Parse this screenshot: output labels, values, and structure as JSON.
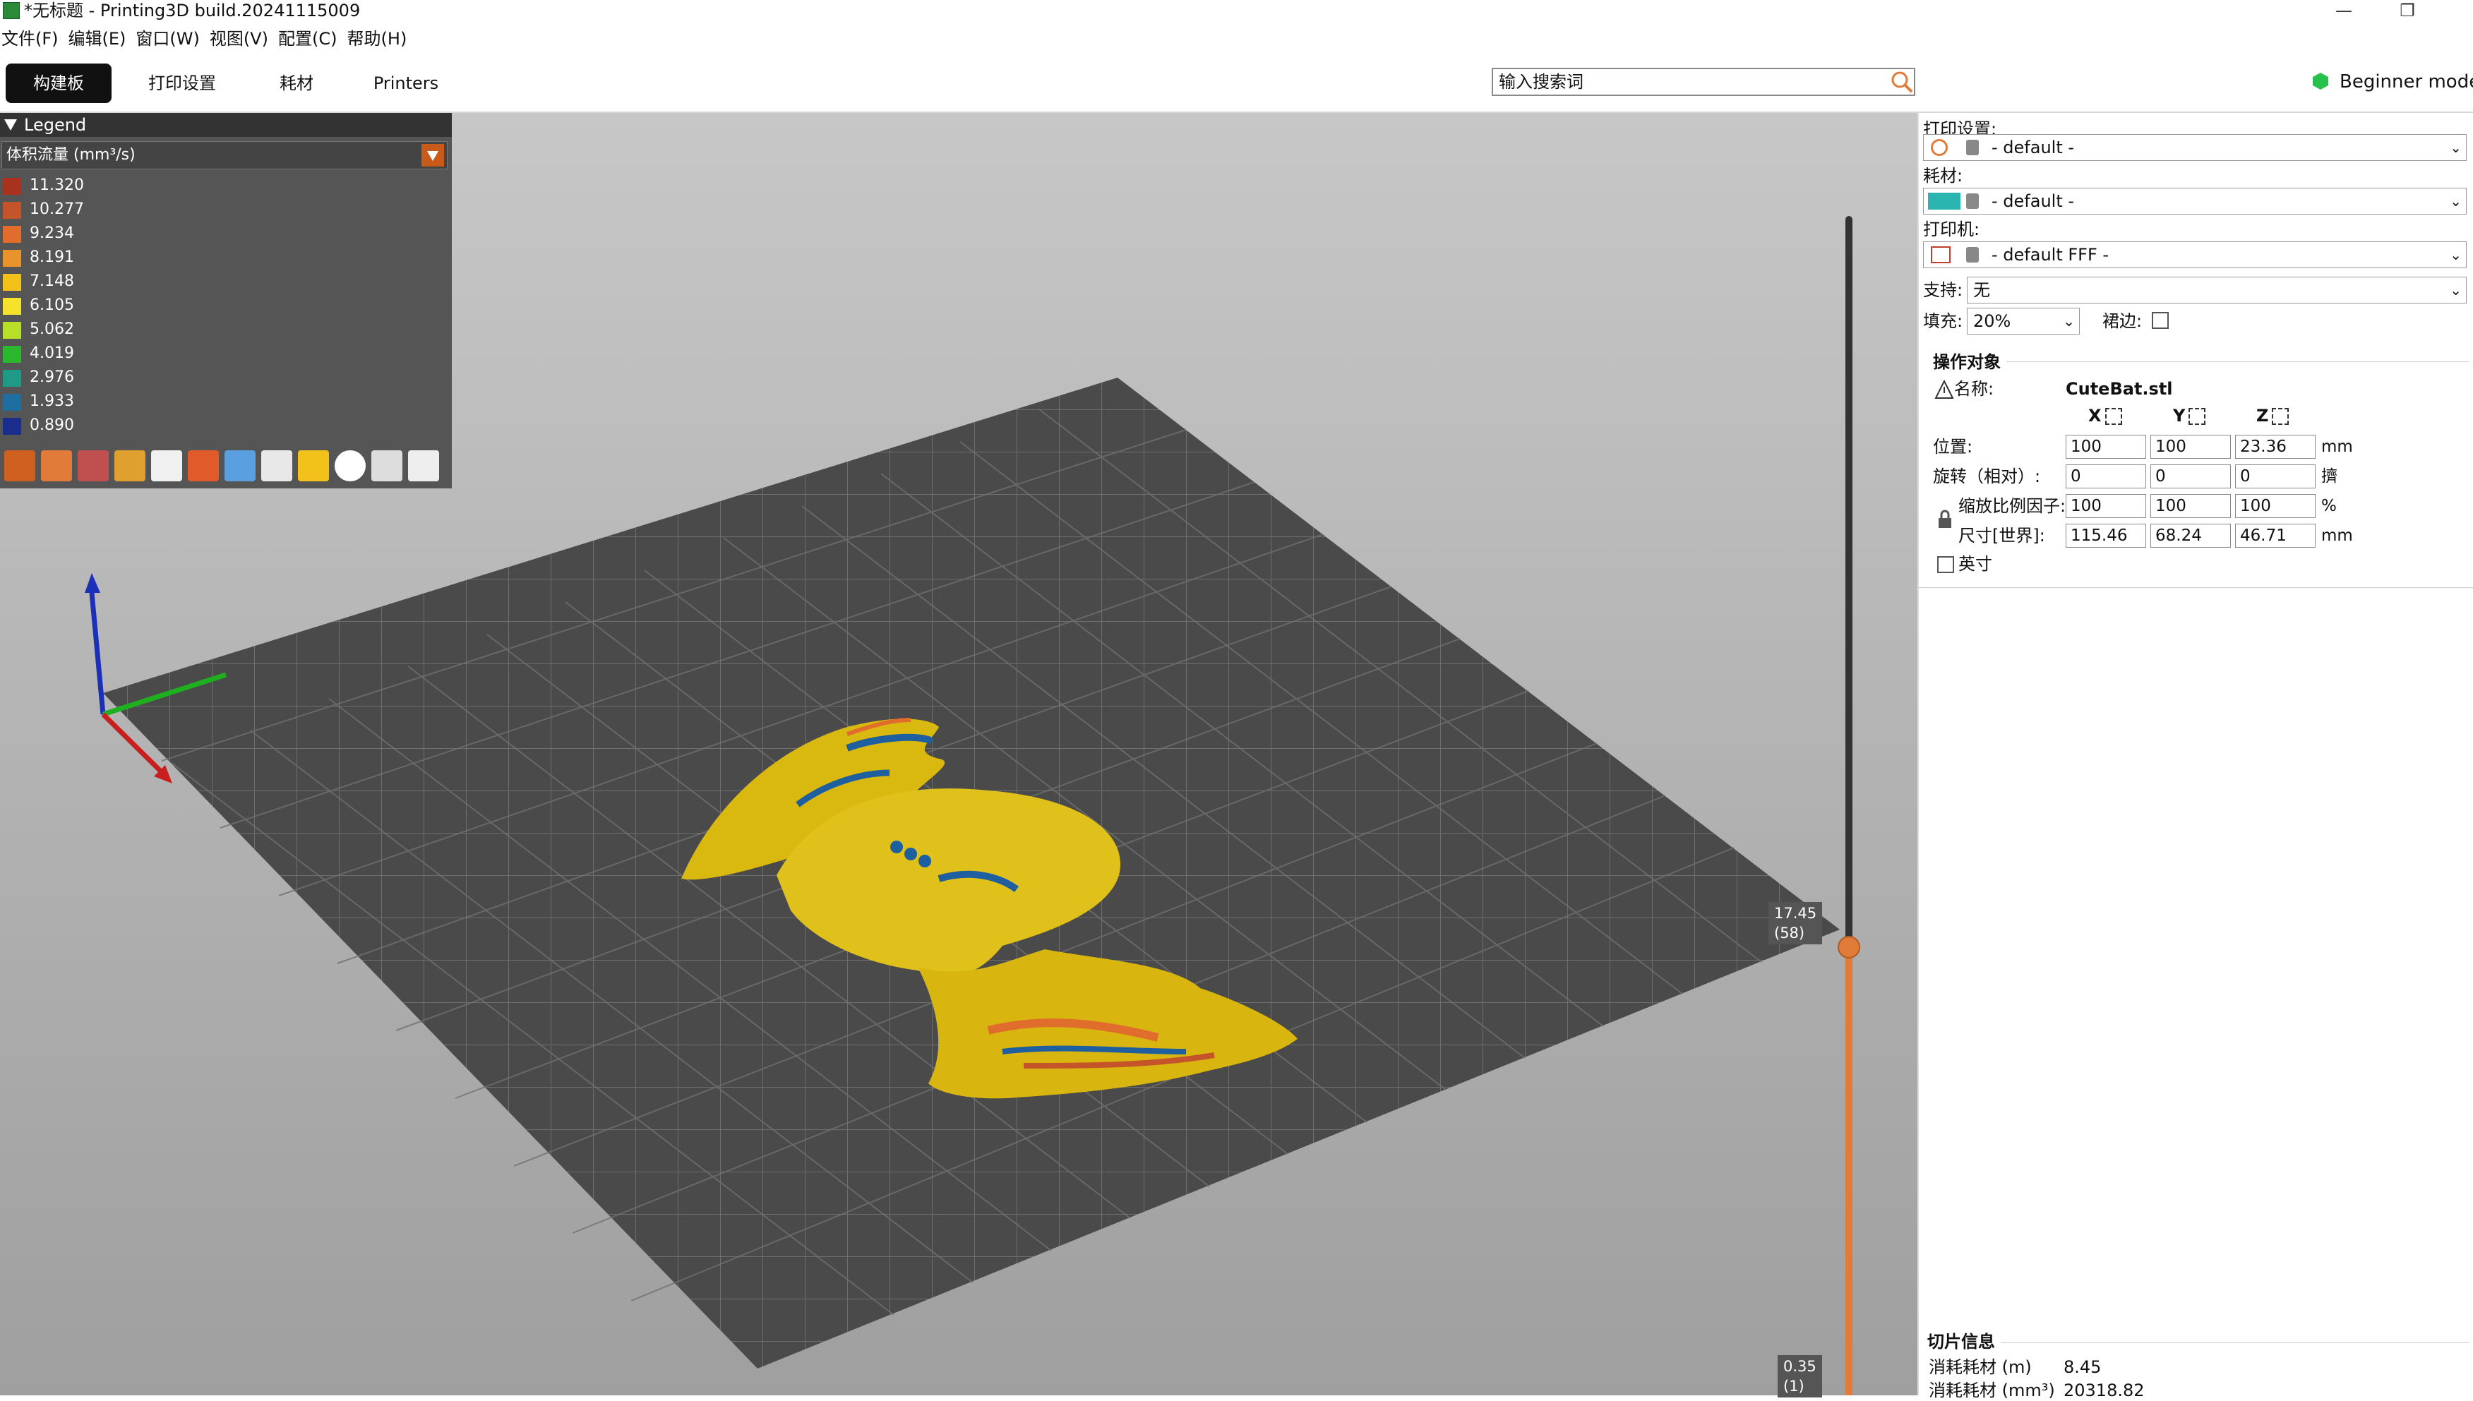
{
  "window": {
    "title": "*无标题 - Printing3D build.20241115009",
    "minimize": "—",
    "restore": "❐"
  },
  "menu": [
    "文件(F)",
    "编辑(E)",
    "窗口(W)",
    "视图(V)",
    "配置(C)",
    "帮助(H)"
  ],
  "tabs": [
    {
      "label": "构建板",
      "active": true
    },
    {
      "label": "打印设置",
      "active": false
    },
    {
      "label": "耗材",
      "active": false
    },
    {
      "label": "Printers",
      "active": false
    }
  ],
  "search": {
    "placeholder": "输入搜索词"
  },
  "mode": {
    "label": "Beginner mode",
    "color": "#27c24c"
  },
  "legend": {
    "title": "Legend",
    "metric": "体积流量 (mm³/s)",
    "items": [
      {
        "value": "11.320",
        "color": "#a8321e"
      },
      {
        "value": "10.277",
        "color": "#c4552a"
      },
      {
        "value": "9.234",
        "color": "#e06d2c"
      },
      {
        "value": "8.191",
        "color": "#e8932b"
      },
      {
        "value": "7.148",
        "color": "#f2c21a"
      },
      {
        "value": "6.105",
        "color": "#f5e22a"
      },
      {
        "value": "5.062",
        "color": "#b8e02a"
      },
      {
        "value": "4.019",
        "color": "#2bb82e"
      },
      {
        "value": "2.976",
        "color": "#1f9a86"
      },
      {
        "value": "1.933",
        "color": "#1e6fa0"
      },
      {
        "value": "0.890",
        "color": "#1a2d8c"
      }
    ]
  },
  "slider": {
    "top_label": "17.45",
    "top_layer": "(58)",
    "bottom_label": "0.35",
    "bottom_layer": "(1)"
  },
  "sidebar": {
    "print_settings_label": "打印设置:",
    "print_settings_value": "- default -",
    "filament_label": "耗材:",
    "filament_value": "- default -",
    "filament_color": "#2bb5b0",
    "printer_label": "打印机:",
    "printer_value": "- default FFF -",
    "support_label": "支持:",
    "support_value": "无",
    "infill_label": "填充:",
    "infill_value": "20%",
    "brim_label": "裙边:",
    "object_section": "操作对象",
    "name_label": "名称:",
    "name_value": "CuteBat.stl",
    "axis_x": "X",
    "axis_y": "Y",
    "axis_z": "Z",
    "position_label": "位置:",
    "position": [
      "100",
      "100",
      "23.36"
    ],
    "position_unit": "mm",
    "rotation_label": "旋转（相对）:",
    "rotation": [
      "0",
      "0",
      "0"
    ],
    "rotation_unit": "擠",
    "scale_label": "缩放比例因子:",
    "scale": [
      "100",
      "100",
      "100"
    ],
    "scale_unit": "%",
    "size_label": "尺寸[世界]:",
    "size": [
      "115.46",
      "68.24",
      "46.71"
    ],
    "size_unit": "mm",
    "inch_label": "英寸",
    "slice_section": "切片信息",
    "used_m_label": "消耗耗材 (m)",
    "used_m_value": "8.45",
    "used_mm3_label": "消耗耗材 (mm³)",
    "used_mm3_value": "20318.82"
  }
}
